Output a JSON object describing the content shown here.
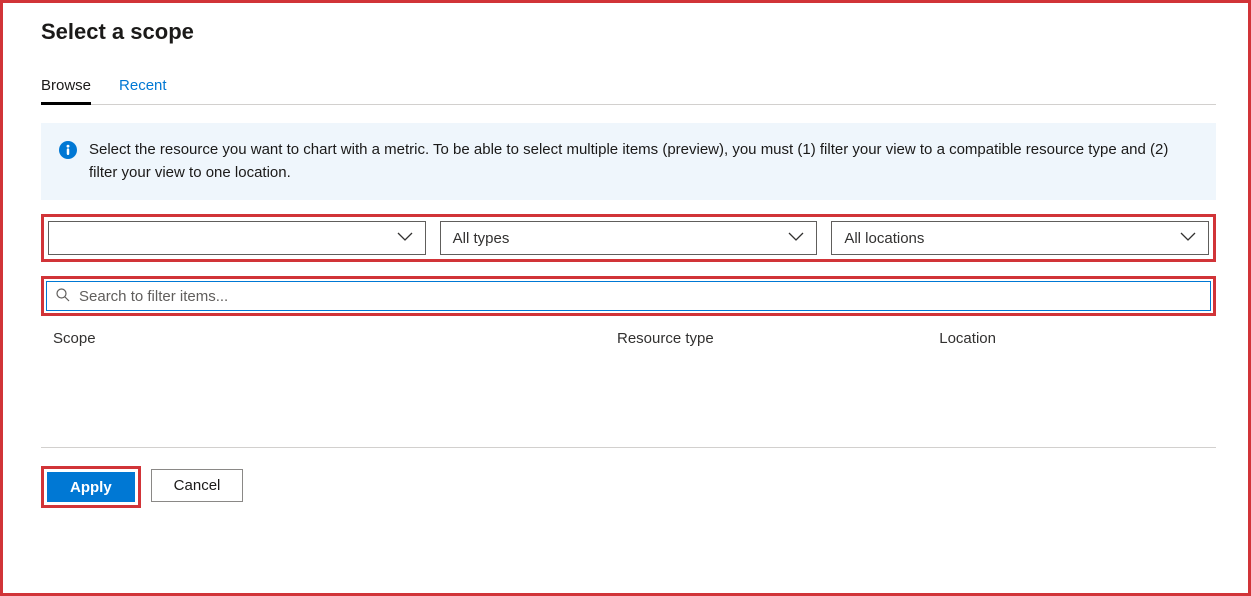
{
  "title": "Select a scope",
  "tabs": {
    "browse": "Browse",
    "recent": "Recent"
  },
  "info": "Select the resource you want to chart with a metric. To be able to select multiple items (preview), you must (1) filter your view to a compatible resource type and (2) filter your view to one location.",
  "filters": {
    "subscription": "",
    "types": "All types",
    "locations": "All locations"
  },
  "search": {
    "placeholder": "Search to filter items..."
  },
  "columns": {
    "scope": "Scope",
    "type": "Resource type",
    "location": "Location"
  },
  "buttons": {
    "apply": "Apply",
    "cancel": "Cancel"
  },
  "colors": {
    "accent": "#0078d4",
    "highlight": "#d13438"
  }
}
